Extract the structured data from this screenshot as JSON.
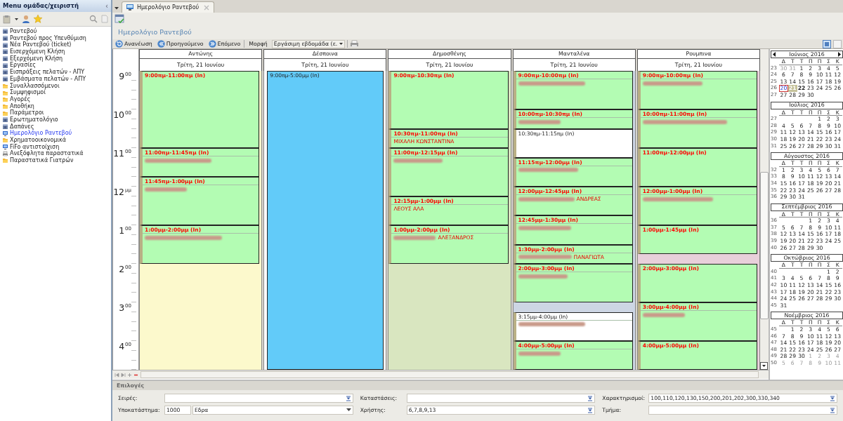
{
  "sidebar": {
    "title": "Menu ομάδας/χειριστή",
    "collapse": "‹",
    "items": [
      {
        "label": "Ραντεβού",
        "kind": "module",
        "selected": false
      },
      {
        "label": "Ραντεβού προς Υπενθύμιση",
        "kind": "module",
        "selected": false
      },
      {
        "label": "Νέα Ραντεβού (ticket)",
        "kind": "module",
        "selected": false
      },
      {
        "label": "Εισερχόμενη Κλήση",
        "kind": "module",
        "selected": false
      },
      {
        "label": "Εξερχόμενη Κλήση",
        "kind": "module",
        "selected": false
      },
      {
        "label": "Εργασίες",
        "kind": "module",
        "selected": false
      },
      {
        "label": "Εισπράξεις πελατών - ΑΠΥ",
        "kind": "module",
        "selected": false
      },
      {
        "label": "Εμβάσματα πελατών - ΑΠΥ",
        "kind": "module",
        "selected": false
      },
      {
        "label": "Συναλλασσόμενοι",
        "kind": "folder",
        "selected": false
      },
      {
        "label": "Συμψηφισμοί",
        "kind": "folder",
        "selected": false
      },
      {
        "label": "Αγορές",
        "kind": "folder",
        "selected": false
      },
      {
        "label": "Αποθήκη",
        "kind": "folder",
        "selected": false
      },
      {
        "label": "Παράμετροι",
        "kind": "folder",
        "selected": false
      },
      {
        "label": "Ερωτηματολόγιο",
        "kind": "module",
        "selected": false
      },
      {
        "label": "Δαπάνες",
        "kind": "module",
        "selected": false
      },
      {
        "label": "Ημερολόγιο Ραντεβού",
        "kind": "screen",
        "selected": true
      },
      {
        "label": "Χρηματοοικονομικά",
        "kind": "folder",
        "selected": false
      },
      {
        "label": "FiFo αντιστοίχιση",
        "kind": "screen",
        "selected": false
      },
      {
        "label": "Ανεξόφλητα παραστατικά",
        "kind": "printer",
        "selected": false
      },
      {
        "label": "Παραστατικά Γιατρών",
        "kind": "folder",
        "selected": false
      }
    ]
  },
  "tab": {
    "label": "Ημερολόγιο Ραντεβού"
  },
  "page_title": "Ημερολόγιο Ραντεβού",
  "toolbar": {
    "buttons": [
      {
        "label": "Ανανέωση",
        "kind": "refresh"
      },
      {
        "label": "Προηγούμενο",
        "kind": "prev"
      },
      {
        "label": "Επόμενο",
        "kind": "next"
      }
    ],
    "view_label": "Μορφή",
    "view_value": "Εργάσιμη εβδομάδα (ε."
  },
  "hours": [
    {
      "hour": "9",
      "suffix": "00"
    },
    {
      "hour": "10",
      "suffix": "00"
    },
    {
      "hour": "11",
      "suffix": "00"
    },
    {
      "hour": "12",
      "suffix": "μμ"
    },
    {
      "hour": "1",
      "suffix": "00"
    },
    {
      "hour": "2",
      "suffix": "00"
    },
    {
      "hour": "3",
      "suffix": "00"
    },
    {
      "hour": "4",
      "suffix": "00"
    }
  ],
  "columns": [
    {
      "name": "Αντώνης",
      "date": "Τρίτη, 21 Ιουνίου",
      "color": "#fcf9cc",
      "appointments": [
        {
          "time": "9:00πμ-11:00πμ (In)",
          "kind": "booked",
          "redacted": false
        },
        {
          "time": "11:00πμ-11:45πμ (In)",
          "kind": "booked",
          "redacted": true
        },
        {
          "time": "11:45πμ-1:00μμ (In)",
          "kind": "booked",
          "redacted": true
        },
        {
          "time": "1:00μμ-2:00μμ (In)",
          "kind": "booked",
          "redacted": true
        }
      ]
    },
    {
      "name": "Δέσποινα",
      "date": "Τρίτη, 21 Ιουνίου",
      "appointments": [
        {
          "time": "9:00πμ-5:00μμ (In)",
          "kind": "busy",
          "redacted": false
        }
      ]
    },
    {
      "name": "Δημοσθένης",
      "date": "Τρίτη, 21 Ιουνίου",
      "color": "#d9e6c0",
      "appointments": [
        {
          "time": "9:00πμ-10:30πμ (In)",
          "kind": "booked",
          "redacted": false
        },
        {
          "time": "10:30πμ-11:00πμ (In)",
          "kind": "booked",
          "redacted": false,
          "client": "ΜΙΧΑΛΗ ΚΩΝΣΤΑΝΤΙΝΑ"
        },
        {
          "time": "11:00πμ-12:15μμ (In)",
          "kind": "booked",
          "redacted": true
        },
        {
          "time": "12:15μμ-1:00μμ (In)",
          "kind": "booked",
          "redacted": false,
          "client": "ΛΕΟΥΣ ΑΛΑ"
        },
        {
          "time": "1:00μμ-2:00μμ (In)",
          "kind": "booked",
          "redacted": true,
          "client": "ΑΛΕΞΑΝΔΡΟΣ"
        }
      ]
    },
    {
      "name": "Μανταλένα",
      "date": "Τρίτη, 21 Ιουνίου",
      "color": "#cdd6e4",
      "appointments": [
        {
          "time": "9:00πμ-10:00πμ (In)",
          "kind": "booked",
          "redacted": true
        },
        {
          "time": "10:00πμ-10:30πμ (In)",
          "kind": "booked",
          "redacted": true
        },
        {
          "time": "10:30πμ-11:15πμ (In)",
          "kind": "open",
          "redacted": false
        },
        {
          "time": "11:15πμ-12:00μμ (In)",
          "kind": "booked",
          "redacted": true
        },
        {
          "time": "12:00μμ-12:45μμ (In)",
          "kind": "booked",
          "redacted": true,
          "client": "ΑΝΔΡΕΑΣ"
        },
        {
          "time": "12:45μμ-1:30μμ (In)",
          "kind": "booked",
          "redacted": true
        },
        {
          "time": "1:30μμ-2:00μμ (In)",
          "kind": "booked",
          "redacted": true,
          "client": "ΠΑΝΑΓΙΩΤΑ"
        },
        {
          "time": "2:00μμ-3:00μμ (In)",
          "kind": "booked",
          "redacted": true
        },
        {
          "time": "3:15μμ-4:00μμ (In)",
          "kind": "open",
          "redacted": true
        },
        {
          "time": "4:00μμ-5:00μμ (In)",
          "kind": "booked",
          "redacted": true
        }
      ]
    },
    {
      "name": "Ρουμπινα",
      "date": "Τρίτη, 21 Ιουνίου",
      "color": "#e8d0da",
      "appointments": [
        {
          "time": "9:00πμ-10:00πμ (In)",
          "kind": "booked",
          "redacted": true
        },
        {
          "time": "10:00πμ-11:00πμ (In)",
          "kind": "booked",
          "redacted": true
        },
        {
          "time": "11:00πμ-12:00μμ (In)",
          "kind": "booked",
          "redacted": false
        },
        {
          "time": "12:00μμ-1:00μμ (In)",
          "kind": "booked",
          "redacted": true
        },
        {
          "time": "1:00μμ-1:45μμ (In)",
          "kind": "booked",
          "redacted": false
        },
        {
          "time": "2:00μμ-3:00μμ (In)",
          "kind": "booked",
          "redacted": false
        },
        {
          "time": "3:00μμ-4:00μμ (In)",
          "kind": "booked",
          "redacted": true
        },
        {
          "time": "4:00μμ-5:00μμ (In)",
          "kind": "booked",
          "redacted": false
        }
      ]
    }
  ],
  "months": [
    {
      "title": "Ιούνιος 2016",
      "weekdays": [
        "Δ",
        "Τ",
        "Τ",
        "Π",
        "Π",
        "Σ",
        "Κ"
      ],
      "weeks": [
        {
          "week": "23",
          "days": [
            {
              "n": "30",
              "kind": "other"
            },
            {
              "n": "31",
              "kind": "other"
            },
            {
              "n": "1",
              "kind": "day"
            },
            {
              "n": "2",
              "kind": "day"
            },
            {
              "n": "3",
              "kind": "day"
            },
            {
              "n": "4",
              "kind": "day"
            },
            {
              "n": "5",
              "kind": "day"
            }
          ]
        },
        {
          "week": "24",
          "days": [
            {
              "n": "6",
              "kind": "day"
            },
            {
              "n": "7",
              "kind": "day"
            },
            {
              "n": "8",
              "kind": "day"
            },
            {
              "n": "9",
              "kind": "day"
            },
            {
              "n": "10",
              "kind": "day"
            },
            {
              "n": "11",
              "kind": "day"
            },
            {
              "n": "12",
              "kind": "day"
            }
          ]
        },
        {
          "week": "25",
          "days": [
            {
              "n": "13",
              "kind": "day"
            },
            {
              "n": "14",
              "kind": "day"
            },
            {
              "n": "15",
              "kind": "day"
            },
            {
              "n": "16",
              "kind": "day"
            },
            {
              "n": "17",
              "kind": "day"
            },
            {
              "n": "18",
              "kind": "day"
            },
            {
              "n": "19",
              "kind": "day"
            }
          ]
        },
        {
          "week": "26",
          "days": [
            {
              "n": "20",
              "kind": "selected"
            },
            {
              "n": "21",
              "kind": "today"
            },
            {
              "n": "22",
              "kind": "bold"
            },
            {
              "n": "23",
              "kind": "day"
            },
            {
              "n": "24",
              "kind": "day"
            },
            {
              "n": "25",
              "kind": "day"
            },
            {
              "n": "26",
              "kind": "day"
            }
          ]
        },
        {
          "week": "27",
          "days": [
            {
              "n": "27",
              "kind": "day"
            },
            {
              "n": "28",
              "kind": "day"
            },
            {
              "n": "29",
              "kind": "day"
            },
            {
              "n": "30",
              "kind": "day"
            }
          ]
        }
      ]
    },
    {
      "title": "Ιούλιος 2016",
      "weekdays": [
        "Δ",
        "Τ",
        "Τ",
        "Π",
        "Π",
        "Σ",
        "Κ"
      ],
      "weeks": [
        {
          "week": "27",
          "days": [
            {
              "n": "1",
              "kind": "day"
            },
            {
              "n": "2",
              "kind": "day"
            },
            {
              "n": "3",
              "kind": "day"
            }
          ]
        },
        {
          "week": "28",
          "days": [
            {
              "n": "4",
              "kind": "day"
            },
            {
              "n": "5",
              "kind": "day"
            },
            {
              "n": "6",
              "kind": "day"
            },
            {
              "n": "7",
              "kind": "day"
            },
            {
              "n": "8",
              "kind": "day"
            },
            {
              "n": "9",
              "kind": "day"
            },
            {
              "n": "10",
              "kind": "day"
            }
          ]
        },
        {
          "week": "29",
          "days": [
            {
              "n": "11",
              "kind": "day"
            },
            {
              "n": "12",
              "kind": "day"
            },
            {
              "n": "13",
              "kind": "day"
            },
            {
              "n": "14",
              "kind": "day"
            },
            {
              "n": "15",
              "kind": "day"
            },
            {
              "n": "16",
              "kind": "day"
            },
            {
              "n": "17",
              "kind": "day"
            }
          ]
        },
        {
          "week": "30",
          "days": [
            {
              "n": "18",
              "kind": "day"
            },
            {
              "n": "19",
              "kind": "day"
            },
            {
              "n": "20",
              "kind": "day"
            },
            {
              "n": "21",
              "kind": "day"
            },
            {
              "n": "22",
              "kind": "day"
            },
            {
              "n": "23",
              "kind": "day"
            },
            {
              "n": "24",
              "kind": "day"
            }
          ]
        },
        {
          "week": "31",
          "days": [
            {
              "n": "25",
              "kind": "day"
            },
            {
              "n": "26",
              "kind": "day"
            },
            {
              "n": "27",
              "kind": "day"
            },
            {
              "n": "28",
              "kind": "day"
            },
            {
              "n": "29",
              "kind": "day"
            },
            {
              "n": "30",
              "kind": "day"
            },
            {
              "n": "31",
              "kind": "day"
            }
          ]
        }
      ]
    },
    {
      "title": "Αύγουστος 2016",
      "weekdays": [
        "Δ",
        "Τ",
        "Τ",
        "Π",
        "Π",
        "Σ",
        "Κ"
      ],
      "weeks": [
        {
          "week": "32",
          "days": [
            {
              "n": "1",
              "kind": "day"
            },
            {
              "n": "2",
              "kind": "day"
            },
            {
              "n": "3",
              "kind": "day"
            },
            {
              "n": "4",
              "kind": "day"
            },
            {
              "n": "5",
              "kind": "day"
            },
            {
              "n": "6",
              "kind": "day"
            },
            {
              "n": "7",
              "kind": "day"
            }
          ]
        },
        {
          "week": "33",
          "days": [
            {
              "n": "8",
              "kind": "day"
            },
            {
              "n": "9",
              "kind": "day"
            },
            {
              "n": "10",
              "kind": "day"
            },
            {
              "n": "11",
              "kind": "day"
            },
            {
              "n": "12",
              "kind": "day"
            },
            {
              "n": "13",
              "kind": "day"
            },
            {
              "n": "14",
              "kind": "day"
            }
          ]
        },
        {
          "week": "34",
          "days": [
            {
              "n": "15",
              "kind": "day"
            },
            {
              "n": "16",
              "kind": "day"
            },
            {
              "n": "17",
              "kind": "day"
            },
            {
              "n": "18",
              "kind": "day"
            },
            {
              "n": "19",
              "kind": "day"
            },
            {
              "n": "20",
              "kind": "day"
            },
            {
              "n": "21",
              "kind": "day"
            }
          ]
        },
        {
          "week": "35",
          "days": [
            {
              "n": "22",
              "kind": "day"
            },
            {
              "n": "23",
              "kind": "day"
            },
            {
              "n": "24",
              "kind": "day"
            },
            {
              "n": "25",
              "kind": "day"
            },
            {
              "n": "26",
              "kind": "day"
            },
            {
              "n": "27",
              "kind": "day"
            },
            {
              "n": "28",
              "kind": "day"
            }
          ]
        },
        {
          "week": "36",
          "days": [
            {
              "n": "29",
              "kind": "day"
            },
            {
              "n": "30",
              "kind": "day"
            },
            {
              "n": "31",
              "kind": "day"
            }
          ]
        }
      ]
    },
    {
      "title": "Σεπτέμβριος 2016",
      "weekdays": [
        "Δ",
        "Τ",
        "Τ",
        "Π",
        "Π",
        "Σ",
        "Κ"
      ],
      "weeks": [
        {
          "week": "36",
          "days": [
            {
              "n": "1",
              "kind": "day"
            },
            {
              "n": "2",
              "kind": "day"
            },
            {
              "n": "3",
              "kind": "day"
            },
            {
              "n": "4",
              "kind": "day"
            }
          ]
        },
        {
          "week": "37",
          "days": [
            {
              "n": "5",
              "kind": "day"
            },
            {
              "n": "6",
              "kind": "day"
            },
            {
              "n": "7",
              "kind": "day"
            },
            {
              "n": "8",
              "kind": "day"
            },
            {
              "n": "9",
              "kind": "day"
            },
            {
              "n": "10",
              "kind": "day"
            },
            {
              "n": "11",
              "kind": "day"
            }
          ]
        },
        {
          "week": "38",
          "days": [
            {
              "n": "12",
              "kind": "day"
            },
            {
              "n": "13",
              "kind": "day"
            },
            {
              "n": "14",
              "kind": "day"
            },
            {
              "n": "15",
              "kind": "day"
            },
            {
              "n": "16",
              "kind": "day"
            },
            {
              "n": "17",
              "kind": "day"
            },
            {
              "n": "18",
              "kind": "day"
            }
          ]
        },
        {
          "week": "39",
          "days": [
            {
              "n": "19",
              "kind": "day"
            },
            {
              "n": "20",
              "kind": "day"
            },
            {
              "n": "21",
              "kind": "day"
            },
            {
              "n": "22",
              "kind": "day"
            },
            {
              "n": "23",
              "kind": "day"
            },
            {
              "n": "24",
              "kind": "day"
            },
            {
              "n": "25",
              "kind": "day"
            }
          ]
        },
        {
          "week": "40",
          "days": [
            {
              "n": "26",
              "kind": "day"
            },
            {
              "n": "27",
              "kind": "day"
            },
            {
              "n": "28",
              "kind": "day"
            },
            {
              "n": "29",
              "kind": "day"
            },
            {
              "n": "30",
              "kind": "day"
            }
          ]
        }
      ]
    },
    {
      "title": "Οκτώβριος 2016",
      "weekdays": [
        "Δ",
        "Τ",
        "Τ",
        "Π",
        "Π",
        "Σ",
        "Κ"
      ],
      "weeks": [
        {
          "week": "40",
          "days": [
            {
              "n": "1",
              "kind": "day"
            },
            {
              "n": "2",
              "kind": "day"
            }
          ]
        },
        {
          "week": "41",
          "days": [
            {
              "n": "3",
              "kind": "day"
            },
            {
              "n": "4",
              "kind": "day"
            },
            {
              "n": "5",
              "kind": "day"
            },
            {
              "n": "6",
              "kind": "day"
            },
            {
              "n": "7",
              "kind": "day"
            },
            {
              "n": "8",
              "kind": "day"
            },
            {
              "n": "9",
              "kind": "day"
            }
          ]
        },
        {
          "week": "42",
          "days": [
            {
              "n": "10",
              "kind": "day"
            },
            {
              "n": "11",
              "kind": "day"
            },
            {
              "n": "12",
              "kind": "day"
            },
            {
              "n": "13",
              "kind": "day"
            },
            {
              "n": "14",
              "kind": "day"
            },
            {
              "n": "15",
              "kind": "day"
            },
            {
              "n": "16",
              "kind": "day"
            }
          ]
        },
        {
          "week": "43",
          "days": [
            {
              "n": "17",
              "kind": "day"
            },
            {
              "n": "18",
              "kind": "day"
            },
            {
              "n": "19",
              "kind": "day"
            },
            {
              "n": "20",
              "kind": "day"
            },
            {
              "n": "21",
              "kind": "day"
            },
            {
              "n": "22",
              "kind": "day"
            },
            {
              "n": "23",
              "kind": "day"
            }
          ]
        },
        {
          "week": "44",
          "days": [
            {
              "n": "24",
              "kind": "day"
            },
            {
              "n": "25",
              "kind": "day"
            },
            {
              "n": "26",
              "kind": "day"
            },
            {
              "n": "27",
              "kind": "day"
            },
            {
              "n": "28",
              "kind": "day"
            },
            {
              "n": "29",
              "kind": "day"
            },
            {
              "n": "30",
              "kind": "day"
            }
          ]
        },
        {
          "week": "45",
          "days": [
            {
              "n": "31",
              "kind": "day"
            }
          ]
        }
      ]
    },
    {
      "title": "Νοέμβριος 2016",
      "weekdays": [
        "Δ",
        "Τ",
        "Τ",
        "Π",
        "Π",
        "Σ",
        "Κ"
      ],
      "weeks": [
        {
          "week": "45",
          "days": [
            {
              "n": "1",
              "kind": "day"
            },
            {
              "n": "2",
              "kind": "day"
            },
            {
              "n": "3",
              "kind": "day"
            },
            {
              "n": "4",
              "kind": "day"
            },
            {
              "n": "5",
              "kind": "day"
            },
            {
              "n": "6",
              "kind": "day"
            }
          ]
        },
        {
          "week": "46",
          "days": [
            {
              "n": "7",
              "kind": "day"
            },
            {
              "n": "8",
              "kind": "day"
            },
            {
              "n": "9",
              "kind": "day"
            },
            {
              "n": "10",
              "kind": "day"
            },
            {
              "n": "11",
              "kind": "day"
            },
            {
              "n": "12",
              "kind": "day"
            },
            {
              "n": "13",
              "kind": "day"
            }
          ]
        },
        {
          "week": "47",
          "days": [
            {
              "n": "14",
              "kind": "day"
            },
            {
              "n": "15",
              "kind": "day"
            },
            {
              "n": "16",
              "kind": "day"
            },
            {
              "n": "17",
              "kind": "day"
            },
            {
              "n": "18",
              "kind": "day"
            },
            {
              "n": "19",
              "kind": "day"
            },
            {
              "n": "20",
              "kind": "day"
            }
          ]
        },
        {
          "week": "48",
          "days": [
            {
              "n": "21",
              "kind": "day"
            },
            {
              "n": "22",
              "kind": "day"
            },
            {
              "n": "23",
              "kind": "day"
            },
            {
              "n": "24",
              "kind": "day"
            },
            {
              "n": "25",
              "kind": "day"
            },
            {
              "n": "26",
              "kind": "day"
            },
            {
              "n": "27",
              "kind": "day"
            }
          ]
        },
        {
          "week": "49",
          "days": [
            {
              "n": "28",
              "kind": "day"
            },
            {
              "n": "29",
              "kind": "day"
            },
            {
              "n": "30",
              "kind": "day"
            },
            {
              "n": "1",
              "kind": "other"
            },
            {
              "n": "2",
              "kind": "other"
            },
            {
              "n": "3",
              "kind": "other"
            },
            {
              "n": "4",
              "kind": "other"
            }
          ]
        },
        {
          "week": "50",
          "days": [
            {
              "n": "5",
              "kind": "other"
            },
            {
              "n": "6",
              "kind": "other"
            },
            {
              "n": "7",
              "kind": "other"
            },
            {
              "n": "8",
              "kind": "other"
            },
            {
              "n": "9",
              "kind": "other"
            },
            {
              "n": "10",
              "kind": "other"
            },
            {
              "n": "11",
              "kind": "other"
            }
          ]
        }
      ]
    }
  ],
  "options": {
    "title": "Επιλογές",
    "fields": [
      {
        "label": "Σειρές:",
        "kind": "lookup"
      },
      {
        "label": "Καταστάσεις:",
        "kind": "lookup"
      },
      {
        "label": "Χαρακτηρισμοί:",
        "kind": "lookup",
        "value": "100,110,120,130,150,200,201,202,300,330,340"
      },
      {
        "label": "Υποκατάστημα:",
        "kind": "dropdown",
        "code": "1000",
        "value": "Εδρα"
      },
      {
        "label": "Χρήστης:",
        "kind": "lookup",
        "value": "6,7,8,9,13"
      },
      {
        "label": "Τμήμα:",
        "kind": "lookup"
      }
    ]
  }
}
